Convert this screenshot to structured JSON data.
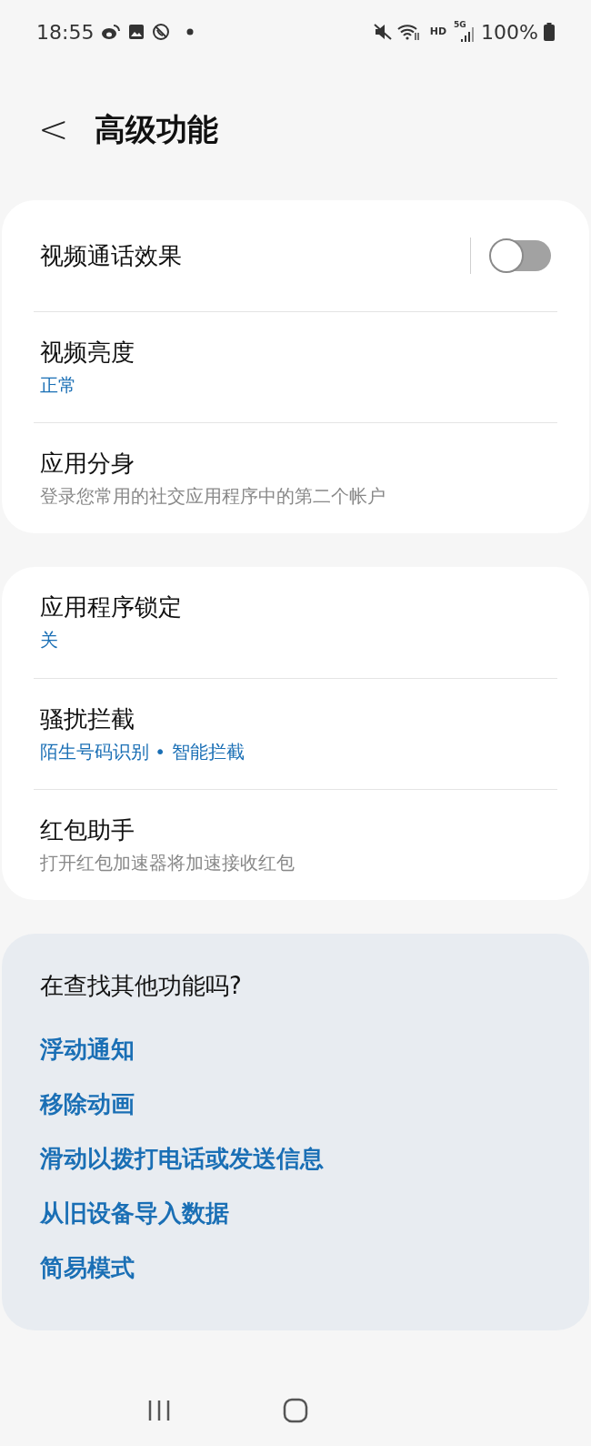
{
  "status_bar": {
    "time": "18:55",
    "network_badge": "HD",
    "network_type": "5G",
    "battery": "100%"
  },
  "header": {
    "back": "<",
    "title": "高级功能"
  },
  "groups": [
    {
      "items": [
        {
          "kind": "toggle",
          "title": "视频通话效果",
          "on": false
        },
        {
          "kind": "value",
          "title": "视频亮度",
          "subtitle": "正常"
        },
        {
          "kind": "description",
          "title": "应用分身",
          "subtitle": "登录您常用的社交应用程序中的第二个帐户"
        }
      ]
    },
    {
      "items": [
        {
          "kind": "value",
          "title": "应用程序锁定",
          "subtitle": "关"
        },
        {
          "kind": "value",
          "title": "骚扰拦截",
          "subtitle": "陌生号码识别 • 智能拦截"
        },
        {
          "kind": "description",
          "title": "红包助手",
          "subtitle": "打开红包加速器将加速接收红包"
        }
      ]
    }
  ],
  "suggestions": {
    "title": "在查找其他功能吗?",
    "links": [
      "浮动通知",
      "移除动画",
      "滑动以拨打电话或发送信息",
      "从旧设备导入数据",
      "简易模式"
    ]
  }
}
